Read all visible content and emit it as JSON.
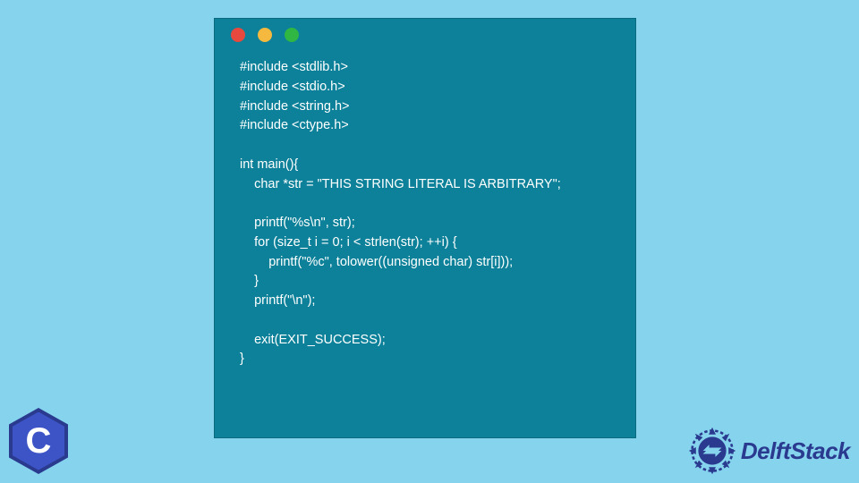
{
  "code": {
    "lines": [
      "#include <stdlib.h>",
      "#include <stdio.h>",
      "#include <string.h>",
      "#include <ctype.h>",
      "",
      "int main(){",
      "    char *str = \"THIS STRING LITERAL IS ARBITRARY\";",
      "",
      "    printf(\"%s\\n\", str);",
      "    for (size_t i = 0; i < strlen(str); ++i) {",
      "        printf(\"%c\", tolower((unsigned char) str[i]));",
      "    }",
      "    printf(\"\\n\");",
      "",
      "    exit(EXIT_SUCCESS);",
      "}"
    ]
  },
  "badges": {
    "c_letter": "C",
    "brand": "DelftStack"
  },
  "colors": {
    "bg": "#86d3ee",
    "window": "#0d8199",
    "dot_red": "#e8493e",
    "dot_yellow": "#f4b93e",
    "dot_green": "#30b643",
    "badge_dark": "#2a3a8f",
    "badge_light": "#3d54c6"
  }
}
